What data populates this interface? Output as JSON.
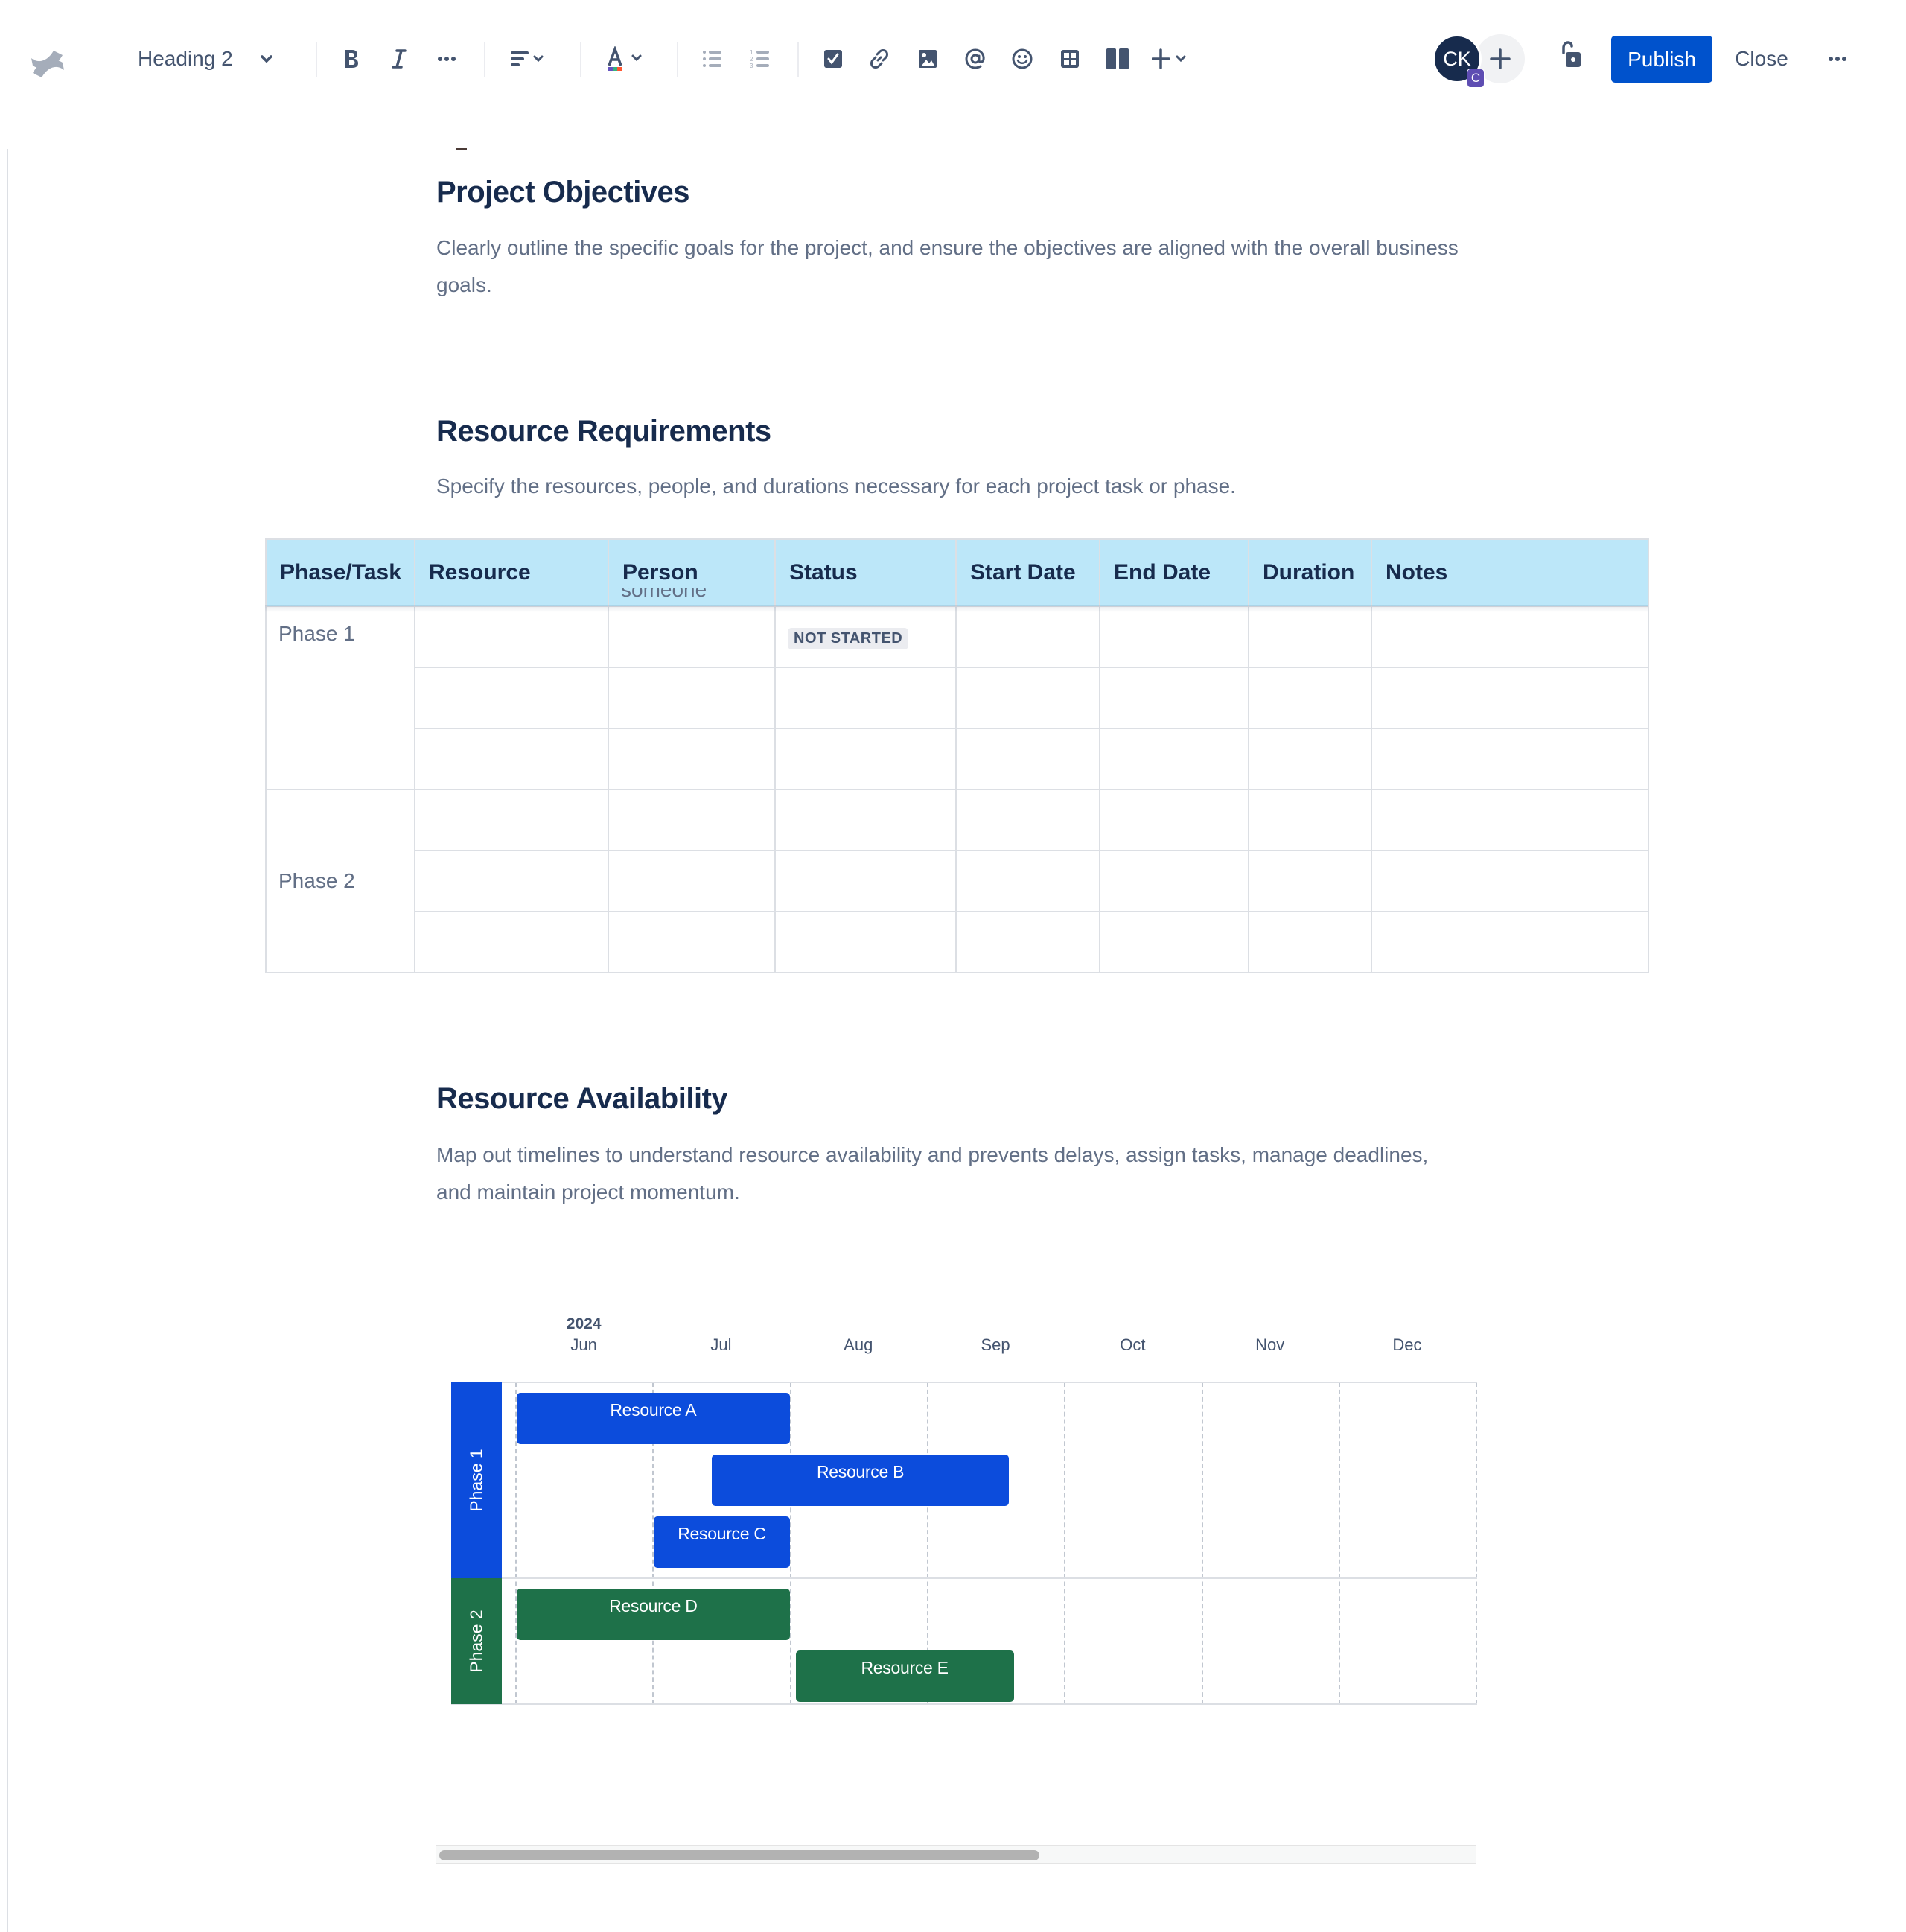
{
  "toolbar": {
    "logo": "confluence-logo",
    "text_style": "Heading 2",
    "icons": {
      "bold": "bold-icon",
      "italic": "italic-icon",
      "more_formatting": "more-icon",
      "alignment": "align-left-icon",
      "text_color": "text-color-icon",
      "bullet_list": "bullet-list-icon",
      "numbered_list": "numbered-list-icon",
      "action_item": "checkbox-icon",
      "link": "link-icon",
      "image": "image-icon",
      "mention": "mention-icon",
      "emoji": "emoji-icon",
      "table": "table-icon",
      "layouts": "layout-icon",
      "insert": "plus-icon"
    },
    "avatar_initials": "CK",
    "avatar_badge": "C",
    "publish_label": "Publish",
    "close_label": "Close",
    "colors": {
      "publish": "#0052CC",
      "avatar": "#172B4D",
      "badge": "#5E4DB2"
    }
  },
  "sections": [
    {
      "heading": "Project Objectives",
      "body": "Clearly outline the specific goals for the project, and ensure the objectives are aligned with the overall business goals."
    },
    {
      "heading": "Resource Requirements",
      "body": "Specify the resources, people, and durations necessary for each project task or phase."
    },
    {
      "heading": "Resource Availability",
      "body": "Map out timelines to understand resource availability and prevents delays, assign tasks, manage deadlines, and maintain project momentum."
    }
  ],
  "table": {
    "header_color": "#BCE7F9",
    "columns": [
      "Phase/Task",
      "Resource",
      "Person",
      "Status",
      "Start Date",
      "End Date",
      "Duration",
      "Notes"
    ],
    "phases": [
      {
        "label": "Phase 1",
        "rows": [
          {
            "resource": "",
            "person": "someone",
            "status": "NOT STARTED",
            "start": "",
            "end": "",
            "duration": "",
            "notes": ""
          },
          {
            "resource": "",
            "person": "",
            "status": "",
            "start": "",
            "end": "",
            "duration": "",
            "notes": ""
          },
          {
            "resource": "",
            "person": "",
            "status": "",
            "start": "",
            "end": "",
            "duration": "",
            "notes": ""
          }
        ]
      },
      {
        "label": "Phase 2",
        "rows": [
          {
            "resource": "",
            "person": "",
            "status": "",
            "start": "",
            "end": "",
            "duration": "",
            "notes": ""
          },
          {
            "resource": "",
            "person": "",
            "status": "",
            "start": "",
            "end": "",
            "duration": "",
            "notes": ""
          },
          {
            "resource": "",
            "person": "",
            "status": "",
            "start": "",
            "end": "",
            "duration": "",
            "notes": ""
          }
        ]
      }
    ]
  },
  "timeline": {
    "year": "2024",
    "months": [
      "Jun",
      "Jul",
      "Aug",
      "Sep",
      "Oct",
      "Nov",
      "Dec"
    ],
    "groups": [
      {
        "label": "Phase 1",
        "color": "#0C4CDC",
        "bars": [
          {
            "label": "Resource A",
            "start": "2024-06-01",
            "end": "2024-07-31"
          },
          {
            "label": "Resource B",
            "start": "2024-07-14",
            "end": "2024-09-18"
          },
          {
            "label": "Resource C",
            "start": "2024-07-01",
            "end": "2024-07-31"
          }
        ]
      },
      {
        "label": "Phase 2",
        "color": "#1E7149",
        "bars": [
          {
            "label": "Resource D",
            "start": "2024-06-01",
            "end": "2024-07-31"
          },
          {
            "label": "Resource E",
            "start": "2024-08-02",
            "end": "2024-09-19"
          }
        ]
      }
    ],
    "scroll_position": {
      "visible_fraction": 0.58,
      "offset": 0
    }
  }
}
